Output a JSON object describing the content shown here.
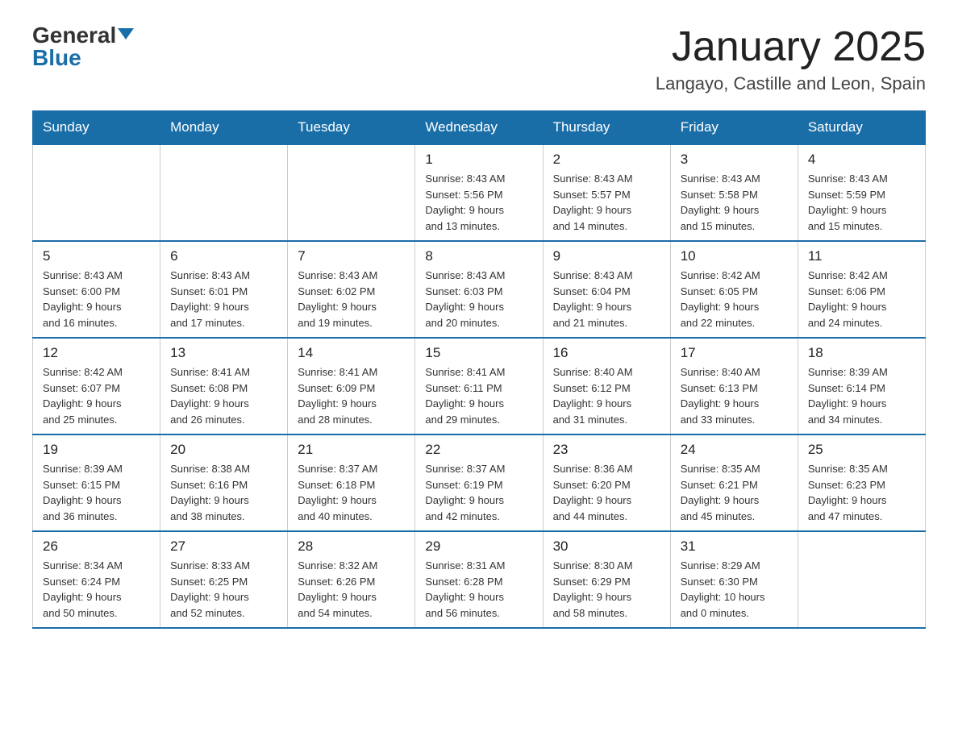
{
  "logo": {
    "general": "General",
    "blue": "Blue"
  },
  "title": "January 2025",
  "location": "Langayo, Castille and Leon, Spain",
  "days_of_week": [
    "Sunday",
    "Monday",
    "Tuesday",
    "Wednesday",
    "Thursday",
    "Friday",
    "Saturday"
  ],
  "weeks": [
    [
      {
        "day": "",
        "info": ""
      },
      {
        "day": "",
        "info": ""
      },
      {
        "day": "",
        "info": ""
      },
      {
        "day": "1",
        "info": "Sunrise: 8:43 AM\nSunset: 5:56 PM\nDaylight: 9 hours\nand 13 minutes."
      },
      {
        "day": "2",
        "info": "Sunrise: 8:43 AM\nSunset: 5:57 PM\nDaylight: 9 hours\nand 14 minutes."
      },
      {
        "day": "3",
        "info": "Sunrise: 8:43 AM\nSunset: 5:58 PM\nDaylight: 9 hours\nand 15 minutes."
      },
      {
        "day": "4",
        "info": "Sunrise: 8:43 AM\nSunset: 5:59 PM\nDaylight: 9 hours\nand 15 minutes."
      }
    ],
    [
      {
        "day": "5",
        "info": "Sunrise: 8:43 AM\nSunset: 6:00 PM\nDaylight: 9 hours\nand 16 minutes."
      },
      {
        "day": "6",
        "info": "Sunrise: 8:43 AM\nSunset: 6:01 PM\nDaylight: 9 hours\nand 17 minutes."
      },
      {
        "day": "7",
        "info": "Sunrise: 8:43 AM\nSunset: 6:02 PM\nDaylight: 9 hours\nand 19 minutes."
      },
      {
        "day": "8",
        "info": "Sunrise: 8:43 AM\nSunset: 6:03 PM\nDaylight: 9 hours\nand 20 minutes."
      },
      {
        "day": "9",
        "info": "Sunrise: 8:43 AM\nSunset: 6:04 PM\nDaylight: 9 hours\nand 21 minutes."
      },
      {
        "day": "10",
        "info": "Sunrise: 8:42 AM\nSunset: 6:05 PM\nDaylight: 9 hours\nand 22 minutes."
      },
      {
        "day": "11",
        "info": "Sunrise: 8:42 AM\nSunset: 6:06 PM\nDaylight: 9 hours\nand 24 minutes."
      }
    ],
    [
      {
        "day": "12",
        "info": "Sunrise: 8:42 AM\nSunset: 6:07 PM\nDaylight: 9 hours\nand 25 minutes."
      },
      {
        "day": "13",
        "info": "Sunrise: 8:41 AM\nSunset: 6:08 PM\nDaylight: 9 hours\nand 26 minutes."
      },
      {
        "day": "14",
        "info": "Sunrise: 8:41 AM\nSunset: 6:09 PM\nDaylight: 9 hours\nand 28 minutes."
      },
      {
        "day": "15",
        "info": "Sunrise: 8:41 AM\nSunset: 6:11 PM\nDaylight: 9 hours\nand 29 minutes."
      },
      {
        "day": "16",
        "info": "Sunrise: 8:40 AM\nSunset: 6:12 PM\nDaylight: 9 hours\nand 31 minutes."
      },
      {
        "day": "17",
        "info": "Sunrise: 8:40 AM\nSunset: 6:13 PM\nDaylight: 9 hours\nand 33 minutes."
      },
      {
        "day": "18",
        "info": "Sunrise: 8:39 AM\nSunset: 6:14 PM\nDaylight: 9 hours\nand 34 minutes."
      }
    ],
    [
      {
        "day": "19",
        "info": "Sunrise: 8:39 AM\nSunset: 6:15 PM\nDaylight: 9 hours\nand 36 minutes."
      },
      {
        "day": "20",
        "info": "Sunrise: 8:38 AM\nSunset: 6:16 PM\nDaylight: 9 hours\nand 38 minutes."
      },
      {
        "day": "21",
        "info": "Sunrise: 8:37 AM\nSunset: 6:18 PM\nDaylight: 9 hours\nand 40 minutes."
      },
      {
        "day": "22",
        "info": "Sunrise: 8:37 AM\nSunset: 6:19 PM\nDaylight: 9 hours\nand 42 minutes."
      },
      {
        "day": "23",
        "info": "Sunrise: 8:36 AM\nSunset: 6:20 PM\nDaylight: 9 hours\nand 44 minutes."
      },
      {
        "day": "24",
        "info": "Sunrise: 8:35 AM\nSunset: 6:21 PM\nDaylight: 9 hours\nand 45 minutes."
      },
      {
        "day": "25",
        "info": "Sunrise: 8:35 AM\nSunset: 6:23 PM\nDaylight: 9 hours\nand 47 minutes."
      }
    ],
    [
      {
        "day": "26",
        "info": "Sunrise: 8:34 AM\nSunset: 6:24 PM\nDaylight: 9 hours\nand 50 minutes."
      },
      {
        "day": "27",
        "info": "Sunrise: 8:33 AM\nSunset: 6:25 PM\nDaylight: 9 hours\nand 52 minutes."
      },
      {
        "day": "28",
        "info": "Sunrise: 8:32 AM\nSunset: 6:26 PM\nDaylight: 9 hours\nand 54 minutes."
      },
      {
        "day": "29",
        "info": "Sunrise: 8:31 AM\nSunset: 6:28 PM\nDaylight: 9 hours\nand 56 minutes."
      },
      {
        "day": "30",
        "info": "Sunrise: 8:30 AM\nSunset: 6:29 PM\nDaylight: 9 hours\nand 58 minutes."
      },
      {
        "day": "31",
        "info": "Sunrise: 8:29 AM\nSunset: 6:30 PM\nDaylight: 10 hours\nand 0 minutes."
      },
      {
        "day": "",
        "info": ""
      }
    ]
  ]
}
